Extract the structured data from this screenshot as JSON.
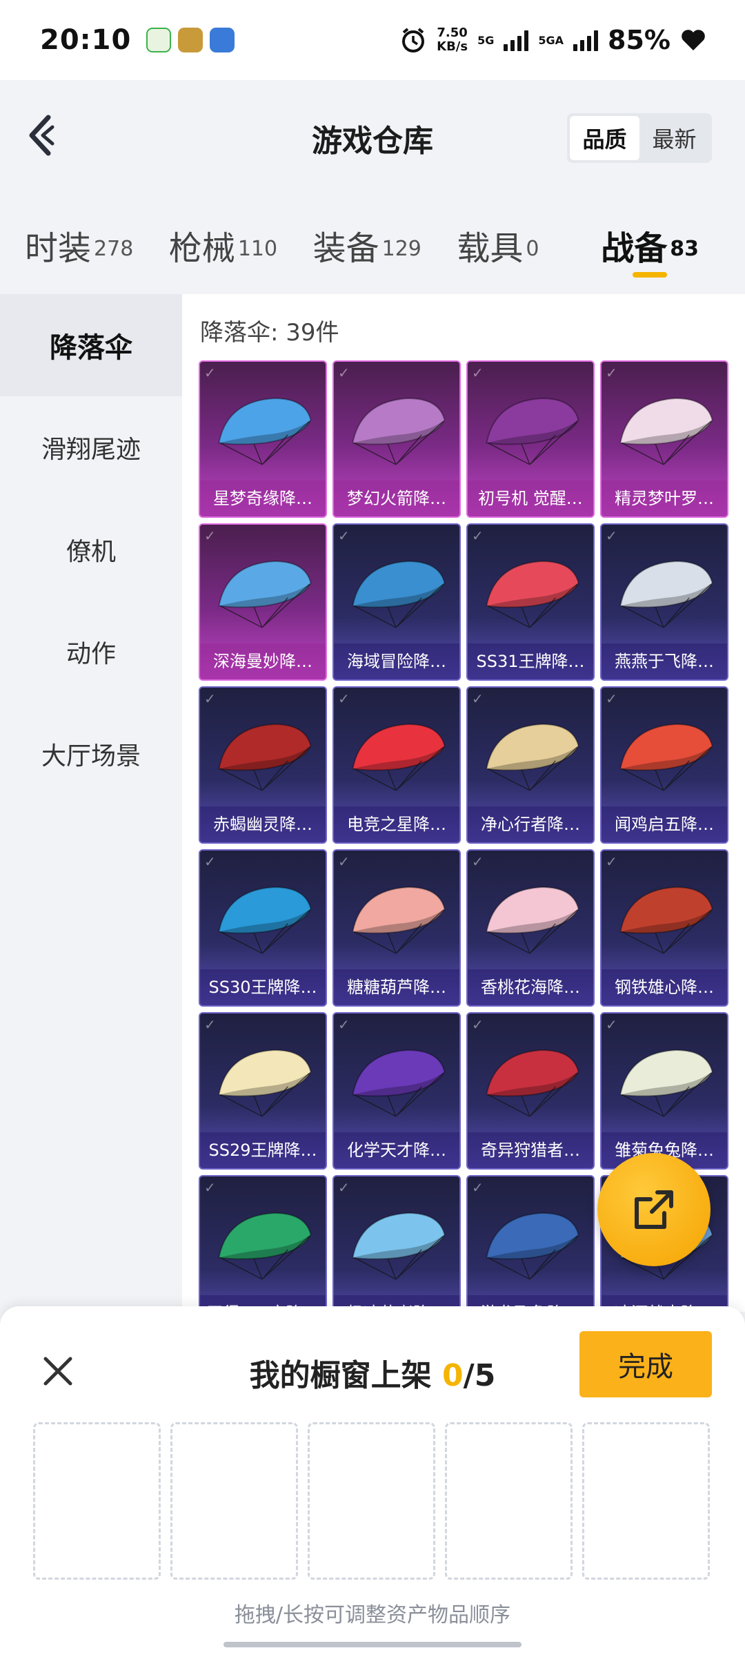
{
  "status_bar": {
    "time": "20:10",
    "speed_value": "7.50",
    "speed_unit": "KB/s",
    "net1": "5G",
    "net2": "5GA",
    "battery": "85%"
  },
  "header": {
    "title": "游戏仓库",
    "sort_options": [
      "品质",
      "最新"
    ],
    "active_sort": "品质"
  },
  "categories": [
    {
      "label": "时装",
      "count": "278"
    },
    {
      "label": "枪械",
      "count": "110"
    },
    {
      "label": "装备",
      "count": "129"
    },
    {
      "label": "载具",
      "count": "0"
    },
    {
      "label": "战备",
      "count": "83"
    }
  ],
  "active_category": "战备",
  "sidebar": {
    "items": [
      "降落伞",
      "滑翔尾迹",
      "僚机",
      "动作",
      "大厅场景"
    ],
    "active": "降落伞"
  },
  "grid": {
    "heading": "降落伞: 39件",
    "items": [
      {
        "name": "星梦奇缘降…",
        "rarity": "pink",
        "color": "#4da3e8"
      },
      {
        "name": "梦幻火箭降…",
        "rarity": "pink",
        "color": "#b77ac7"
      },
      {
        "name": "初号机 觉醒…",
        "rarity": "pink",
        "color": "#8b3a9e"
      },
      {
        "name": "精灵梦叶罗…",
        "rarity": "pink",
        "color": "#f0dce8"
      },
      {
        "name": "深海曼妙降…",
        "rarity": "pink",
        "color": "#5aa9e6"
      },
      {
        "name": "海域冒险降…",
        "rarity": "purple",
        "color": "#3a8fd0"
      },
      {
        "name": "SS31王牌降…",
        "rarity": "purple",
        "color": "#e64a5a"
      },
      {
        "name": "燕燕于飞降…",
        "rarity": "purple",
        "color": "#d8dfe8"
      },
      {
        "name": "赤蝎幽灵降…",
        "rarity": "purple",
        "color": "#b02a2a"
      },
      {
        "name": "电竞之星降…",
        "rarity": "purple",
        "color": "#e8333f"
      },
      {
        "name": "净心行者降…",
        "rarity": "purple",
        "color": "#e6cf9a"
      },
      {
        "name": "闻鸡启五降…",
        "rarity": "purple",
        "color": "#e64e3a"
      },
      {
        "name": "SS30王牌降…",
        "rarity": "purple",
        "color": "#2a9ad8"
      },
      {
        "name": "糖糖葫芦降…",
        "rarity": "purple",
        "color": "#f0a8a0"
      },
      {
        "name": "香桃花海降…",
        "rarity": "purple",
        "color": "#f4c6d4"
      },
      {
        "name": "钢铁雄心降…",
        "rarity": "purple",
        "color": "#c0402e"
      },
      {
        "name": "SS29王牌降…",
        "rarity": "purple",
        "color": "#f3e6b8"
      },
      {
        "name": "化学天才降…",
        "rarity": "purple",
        "color": "#6a3ab8"
      },
      {
        "name": "奇异狩猎者…",
        "rarity": "purple",
        "color": "#c83040"
      },
      {
        "name": "雏菊兔兔降…",
        "rarity": "purple",
        "color": "#e8ecd8"
      },
      {
        "name": "王得PEL亮降…",
        "rarity": "purple",
        "color": "#2aa86a"
      },
      {
        "name": "极冰使者降…",
        "rarity": "purple",
        "color": "#7cc4ee"
      },
      {
        "name": "游龙飞兔降…",
        "rarity": "purple",
        "color": "#3a6ab8"
      },
      {
        "name": "冰河战士降…",
        "rarity": "purple",
        "color": "#6aa0d8"
      }
    ]
  },
  "sheet": {
    "title_prefix": "我的橱窗上架",
    "current": "0",
    "total_suffix": "/5",
    "done_label": "完成",
    "slot_count": 5,
    "hint": "拖拽/长按可调整资产物品顺序"
  }
}
